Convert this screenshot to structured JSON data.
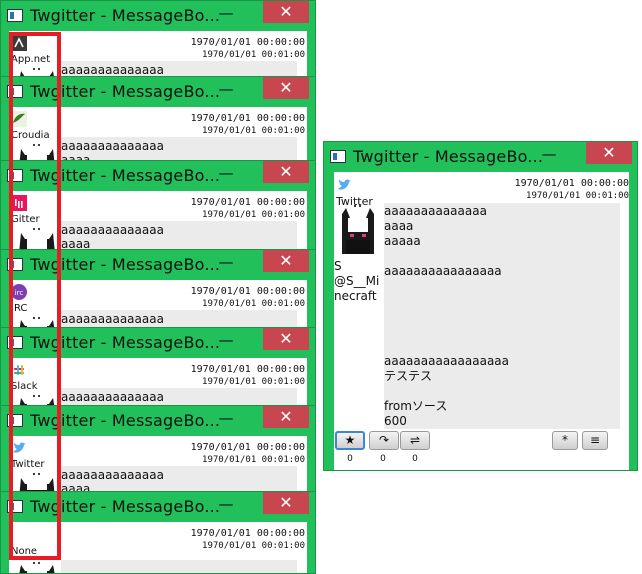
{
  "window_title": "Twgitter - MessageBo...",
  "min_glyph": "—",
  "close_glyph": "✕",
  "date_main": "1970/01/01 00:00:00",
  "date_sub": "1970/01/01 00:01:00",
  "stack": [
    {
      "service": "App.net",
      "line1": "aaaaaaaaaaaaaa",
      "line2": ""
    },
    {
      "service": "Croudia",
      "line1": "aaaaaaaaaaaaaa",
      "line2": "aaaa"
    },
    {
      "service": "Gitter",
      "line1": "aaaaaaaaaaaaaa",
      "line2": "aaaa"
    },
    {
      "service": "IRC",
      "line1": "aaaaaaaaaaaaaa",
      "line2": ""
    },
    {
      "service": "Slack",
      "line1": "aaaaaaaaaaaaaa",
      "line2": ""
    },
    {
      "service": "Twitter",
      "line1": "aaaaaaaaaaaaaa",
      "line2": "aaaa"
    },
    {
      "service": "None",
      "line1": "",
      "line2": ""
    }
  ],
  "detail": {
    "service": "Twitter",
    "user_name": "S\n@S__Mi\nnecraft",
    "message": "aaaaaaaaaaaaaa\naaaa\naaaaa\n\naaaaaaaaaaaaaaaa\n\n\n\n\n\naaaaaaaaaaaaaaaaa\nテステス\n\nfromソース\n600",
    "buttons": {
      "favorite": "★",
      "reply": "↷",
      "retweet": "⇌",
      "more": "*",
      "menu": "≡"
    },
    "counts": {
      "favorite": "0",
      "reply": "0",
      "retweet": "0"
    }
  },
  "colors": {
    "title_bar": "#21c05a",
    "close": "#c8464f",
    "highlight": "#e81c24",
    "twitter": "#55acee",
    "slack": "#e01e5a",
    "irc": "#7a3fb0",
    "gitter": "#e8175d",
    "croudia": "#3d7a2a",
    "appnet": "#3a3a3a"
  }
}
